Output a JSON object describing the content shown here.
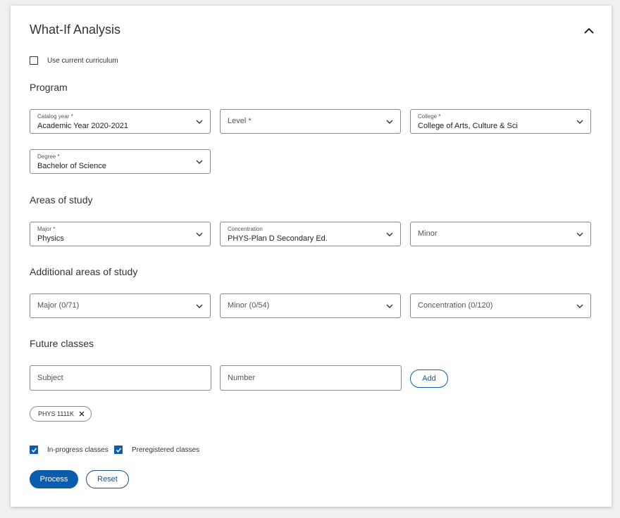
{
  "panel": {
    "title": "What-If Analysis",
    "collapse_icon": "chevron-up-icon"
  },
  "use_current_curriculum": {
    "label": "Use current curriculum",
    "checked": false
  },
  "program": {
    "heading": "Program",
    "catalog_year": {
      "label": "Catalog year *",
      "value": "Academic Year 2020-2021"
    },
    "level": {
      "placeholder": "Level *"
    },
    "college": {
      "label": "College *",
      "value": "College of Arts, Culture & Sci"
    },
    "degree": {
      "label": "Degree *",
      "value": "Bachelor of Science"
    }
  },
  "areas_of_study": {
    "heading": "Areas of study",
    "major": {
      "label": "Major *",
      "value": "Physics"
    },
    "concentration": {
      "label": "Concentration",
      "value": "PHYS-Plan D Secondary Ed."
    },
    "minor": {
      "placeholder": "Minor"
    }
  },
  "additional_areas": {
    "heading": "Additional areas of study",
    "major": {
      "placeholder": "Major (0/71)"
    },
    "minor": {
      "placeholder": "Minor (0/54)"
    },
    "concentration": {
      "placeholder": "Concentration (0/120)"
    }
  },
  "future_classes": {
    "heading": "Future classes",
    "subject_placeholder": "Subject",
    "number_placeholder": "Number",
    "add_label": "Add",
    "chips": [
      {
        "label": "PHYS 1111K"
      }
    ]
  },
  "options": {
    "in_progress": {
      "label": "In-progress classes",
      "checked": true
    },
    "preregistered": {
      "label": "Preregistered classes",
      "checked": true
    }
  },
  "actions": {
    "process_label": "Process",
    "reset_label": "Reset"
  },
  "colors": {
    "accent": "#0b5cad",
    "border": "#8a8a8a"
  }
}
